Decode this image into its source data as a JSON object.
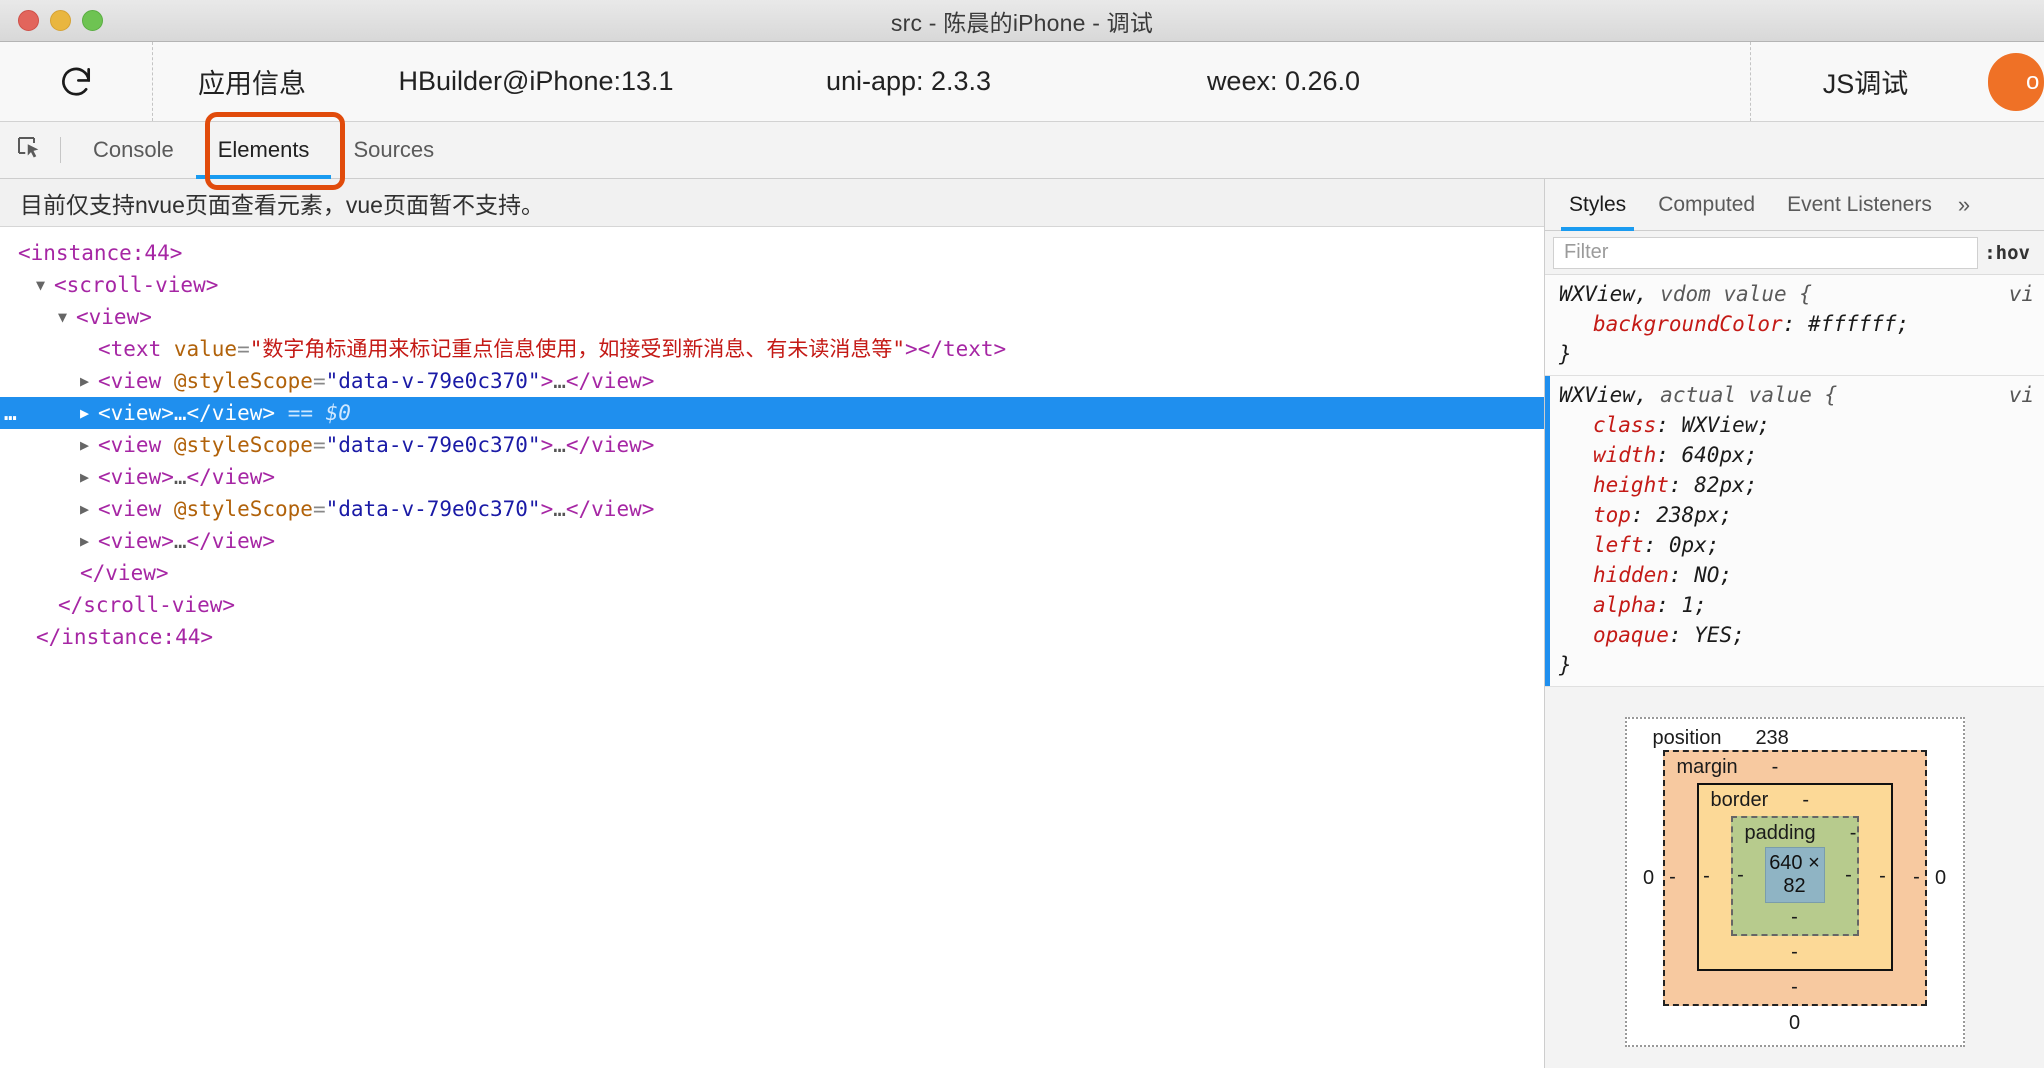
{
  "window": {
    "title": "src - 陈晨的iPhone - 调试",
    "controls": {
      "close": "close",
      "minimize": "minimize",
      "maximize": "maximize"
    }
  },
  "infobar": {
    "reload_icon": "reload-icon",
    "app_info_label": "应用信息",
    "hbuilder_label": "HBuilder@iPhone:13.1",
    "uniapp_label": "uni-app: 2.3.3",
    "weex_label": "weex: 0.26.0",
    "js_debug_label": "JS调试",
    "action_button_label": "o"
  },
  "devtools": {
    "inspect_icon": "inspect-element-icon",
    "tabs": [
      {
        "label": "Console",
        "active": false
      },
      {
        "label": "Elements",
        "active": true
      },
      {
        "label": "Sources",
        "active": false
      }
    ],
    "notice": "目前仅支持nvue页面查看元素，vue页面暂不支持。"
  },
  "dom_tree": {
    "text_value": "数字角标通用来标记重点信息使用，如接受到新消息、有未读消息等",
    "style_scope_attr": "@styleScope",
    "style_scope_value": "data-v-79e0c370",
    "instance_open": "<instance:44>",
    "instance_close": "</instance:44>",
    "scrollview_open": "<scroll-view>",
    "scrollview_close": "</scroll-view>",
    "view_open": "<view>",
    "view_close": "</view>",
    "ellipsis": "…",
    "selected_marker": "== $0",
    "selected_dots": "…"
  },
  "styles_panel": {
    "tabs": [
      {
        "label": "Styles",
        "active": true
      },
      {
        "label": "Computed",
        "active": false
      },
      {
        "label": "Event Listeners",
        "active": false
      }
    ],
    "more_tabs_icon": "»",
    "filter_placeholder": "Filter",
    "hov_button": ":hov",
    "rules": [
      {
        "selector": "WXView,",
        "origin": "vdom value {",
        "source": "vi",
        "marked": false,
        "declarations": [
          {
            "prop": "backgroundColor",
            "value": "#ffffff;"
          }
        ],
        "close": "}"
      },
      {
        "selector": "WXView,",
        "origin": "actual value {",
        "source": "vi",
        "marked": true,
        "declarations": [
          {
            "prop": "class",
            "value": "WXView;"
          },
          {
            "prop": "width",
            "value": "640px;"
          },
          {
            "prop": "height",
            "value": "82px;"
          },
          {
            "prop": "top",
            "value": "238px;"
          },
          {
            "prop": "left",
            "value": "0px;"
          },
          {
            "prop": "hidden",
            "value": "NO;"
          },
          {
            "prop": "alpha",
            "value": "1;"
          },
          {
            "prop": "opaque",
            "value": "YES;"
          }
        ],
        "close": "}"
      }
    ]
  },
  "box_model": {
    "position_label": "position",
    "position_top": "238",
    "position_left": "0",
    "position_right": "0",
    "position_bottom": "0",
    "margin_label": "margin",
    "margin_top": "-",
    "margin_left": "-",
    "margin_right": "-",
    "margin_bottom": "-",
    "border_label": "border",
    "border_top": "-",
    "border_left": "-",
    "border_right": "-",
    "border_bottom": "-",
    "padding_label": "padding",
    "padding_top": "-",
    "padding_left": "-",
    "padding_right": "-",
    "padding_bottom": "-",
    "content_size": "640 × 82"
  },
  "colors": {
    "accent_blue": "#1a9bf0",
    "selection_blue": "#1f8fee",
    "highlight_orange": "#e14b0b",
    "action_orange": "#ef7126",
    "margin_fill": "#f7c9a0",
    "border_fill": "#fcd997",
    "padding_fill": "#b7cb8d",
    "content_fill": "#8fb4c4"
  }
}
